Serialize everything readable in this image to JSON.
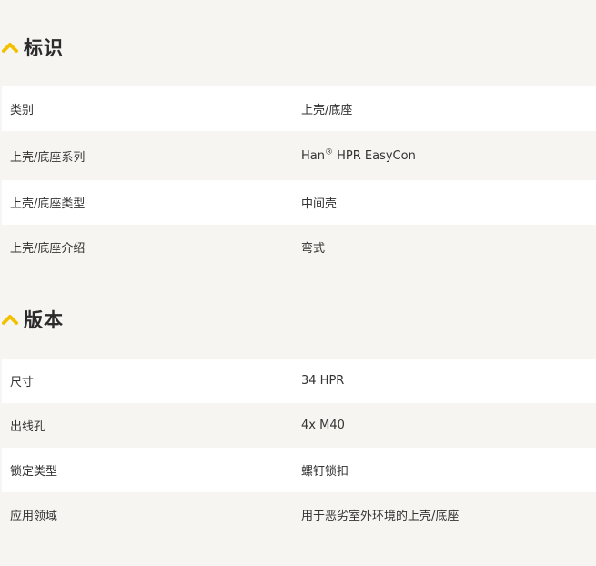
{
  "colors": {
    "accent": "#f2c200",
    "background": "#f6f5f2",
    "row_white": "#ffffff",
    "text": "#333333"
  },
  "sections": [
    {
      "title": "标识",
      "icon": "chevron-up-icon",
      "rows": [
        {
          "label": "类别",
          "value": "上壳/底座"
        },
        {
          "label": "上壳/底座系列",
          "value_main": "Han",
          "value_sup": "®",
          "value_rest": " HPR EasyCon"
        },
        {
          "label": "上壳/底座类型",
          "value": "中间壳"
        },
        {
          "label": "上壳/底座介绍",
          "value": "弯式"
        }
      ]
    },
    {
      "title": "版本",
      "icon": "chevron-up-icon",
      "rows": [
        {
          "label": "尺寸",
          "value": "34 HPR"
        },
        {
          "label": "出线孔",
          "value": "4x M40"
        },
        {
          "label": "锁定类型",
          "value": "螺钉锁扣"
        },
        {
          "label": "应用领域",
          "value": "用于恶劣室外环境的上壳/底座"
        }
      ]
    }
  ]
}
